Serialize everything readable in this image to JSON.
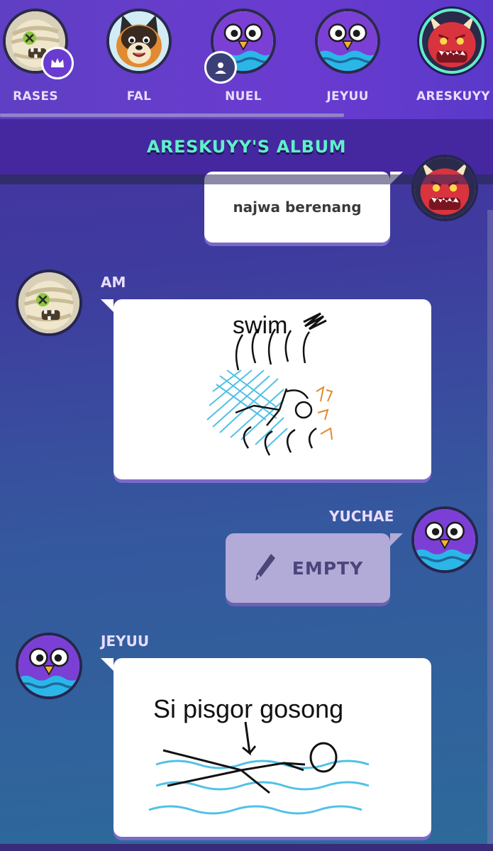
{
  "players": [
    {
      "name": "RASES",
      "avatar": "mummy-avatar",
      "badge": "crown-icon"
    },
    {
      "name": "FAL",
      "avatar": "dog-avatar"
    },
    {
      "name": "NUEL",
      "avatar": "purple-bird-avatar",
      "badge": "user-icon"
    },
    {
      "name": "JEYUU",
      "avatar": "purple-bird-avatar"
    },
    {
      "name": "ARESKUYY",
      "avatar": "red-dragon-avatar",
      "active": true
    }
  ],
  "album": {
    "title": "ARESKUYY'S ALBUM"
  },
  "messages": [
    {
      "author_avatar": "red-dragon-avatar",
      "side": "right",
      "type": "text",
      "text": "najwa berenang"
    },
    {
      "author": "AM",
      "author_avatar": "mummy-avatar",
      "side": "left",
      "type": "drawing",
      "drawing_text": "swim"
    },
    {
      "author": "YUCHAE",
      "author_avatar": "purple-bird-avatar",
      "side": "right",
      "type": "empty",
      "label": "EMPTY",
      "icon": "pencil-icon"
    },
    {
      "author": "JEYUU",
      "author_avatar": "purple-bird-avatar",
      "side": "left",
      "type": "drawing",
      "drawing_text": "Si pisgor gosong"
    }
  ],
  "colors": {
    "accent": "#5ef0c9",
    "header": "#6a3bd0",
    "title_bar": "#4527a0",
    "name_text": "#e8dcff",
    "empty_bubble": "#b2abd8"
  }
}
